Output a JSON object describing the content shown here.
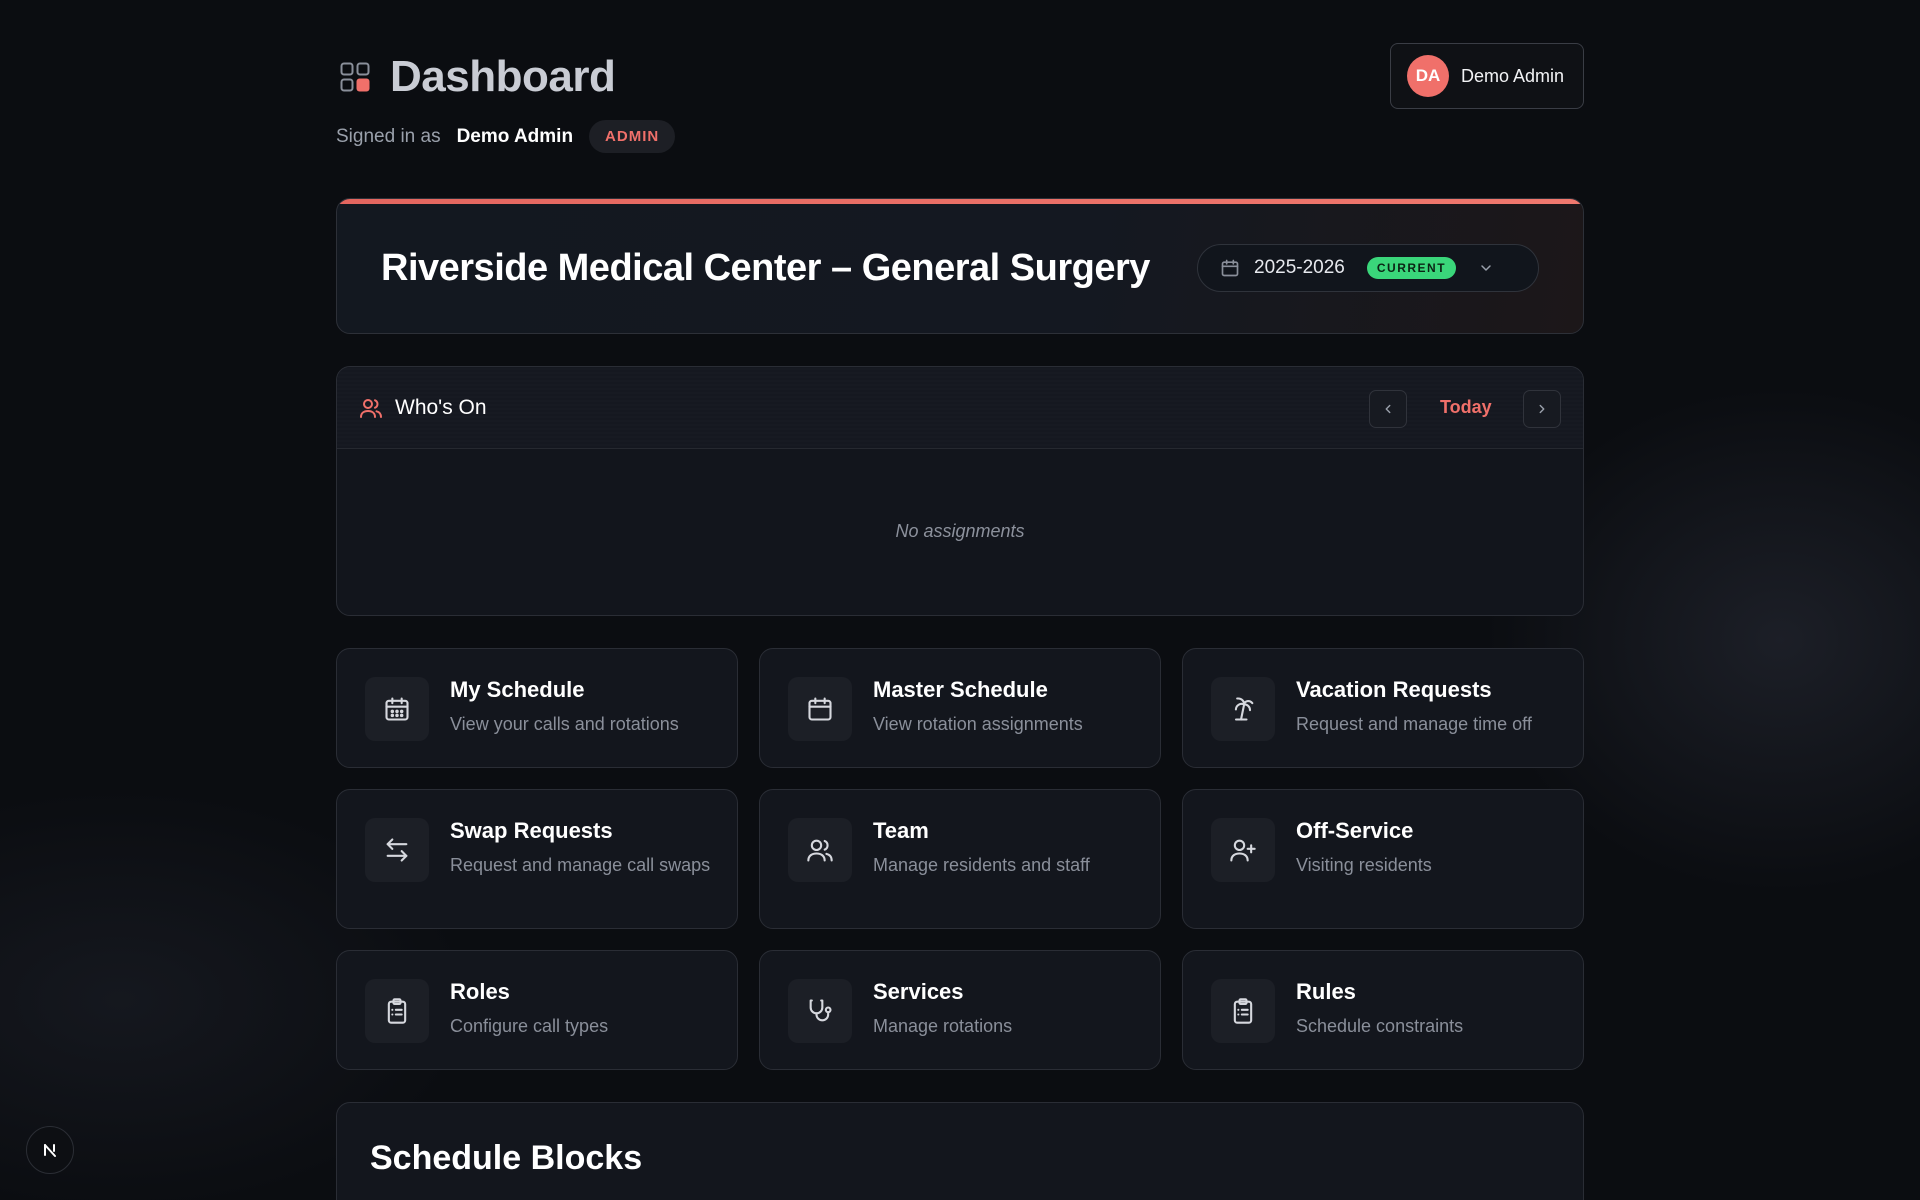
{
  "header": {
    "title": "Dashboard",
    "signed_in_label": "Signed in as",
    "user_name": "Demo Admin",
    "role_badge": "ADMIN",
    "avatar_initials": "DA",
    "user_chip_name": "Demo Admin"
  },
  "program": {
    "title": "Riverside Medical Center – General Surgery",
    "year": "2025-2026",
    "year_status": "CURRENT"
  },
  "whos_on": {
    "title": "Who's On",
    "today_label": "Today",
    "empty_text": "No assignments"
  },
  "tiles": [
    {
      "title": "My Schedule",
      "subtitle": "View your calls and rotations",
      "icon": "calendar-grid-icon"
    },
    {
      "title": "Master Schedule",
      "subtitle": "View rotation assignments",
      "icon": "calendar-icon"
    },
    {
      "title": "Vacation Requests",
      "subtitle": "Request and manage time off",
      "icon": "palm-tree-icon"
    },
    {
      "title": "Swap Requests",
      "subtitle": "Request and manage call swaps",
      "icon": "swap-arrows-icon"
    },
    {
      "title": "Team",
      "subtitle": "Manage residents and staff",
      "icon": "users-icon"
    },
    {
      "title": "Off-Service",
      "subtitle": "Visiting residents",
      "icon": "user-plus-icon"
    },
    {
      "title": "Roles",
      "subtitle": "Configure call types",
      "icon": "clipboard-list-icon"
    },
    {
      "title": "Services",
      "subtitle": "Manage rotations",
      "icon": "stethoscope-icon"
    },
    {
      "title": "Rules",
      "subtitle": "Schedule constraints",
      "icon": "clipboard-list-icon"
    }
  ],
  "schedule_blocks": {
    "title": "Schedule Blocks"
  },
  "colors": {
    "accent": "#f0706a",
    "current_badge": "#3ad67a",
    "background": "#0b0d11",
    "card": "#13161d"
  }
}
